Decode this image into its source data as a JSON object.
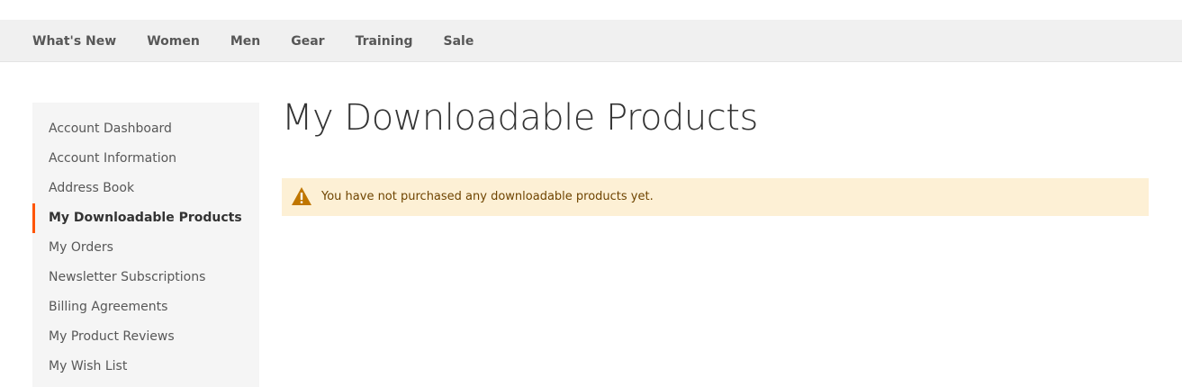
{
  "nav": {
    "items": [
      {
        "label": "What's New"
      },
      {
        "label": "Women"
      },
      {
        "label": "Men"
      },
      {
        "label": "Gear"
      },
      {
        "label": "Training"
      },
      {
        "label": "Sale"
      }
    ]
  },
  "sidebar": {
    "items": [
      {
        "label": "Account Dashboard",
        "current": false
      },
      {
        "label": "Account Information",
        "current": false
      },
      {
        "label": "Address Book",
        "current": false
      },
      {
        "label": "My Downloadable Products",
        "current": true
      },
      {
        "label": "My Orders",
        "current": false
      },
      {
        "label": "Newsletter Subscriptions",
        "current": false
      },
      {
        "label": "Billing Agreements",
        "current": false
      },
      {
        "label": "My Product Reviews",
        "current": false
      },
      {
        "label": "My Wish List",
        "current": false
      }
    ],
    "active_accent_color": "#ff5501"
  },
  "main": {
    "title": "My Downloadable Products",
    "message": {
      "type": "warning",
      "icon": "warning-icon",
      "text": "You have not purchased any downloadable products yet.",
      "background_color": "#fdf0d5",
      "icon_color": "#c07600"
    }
  }
}
